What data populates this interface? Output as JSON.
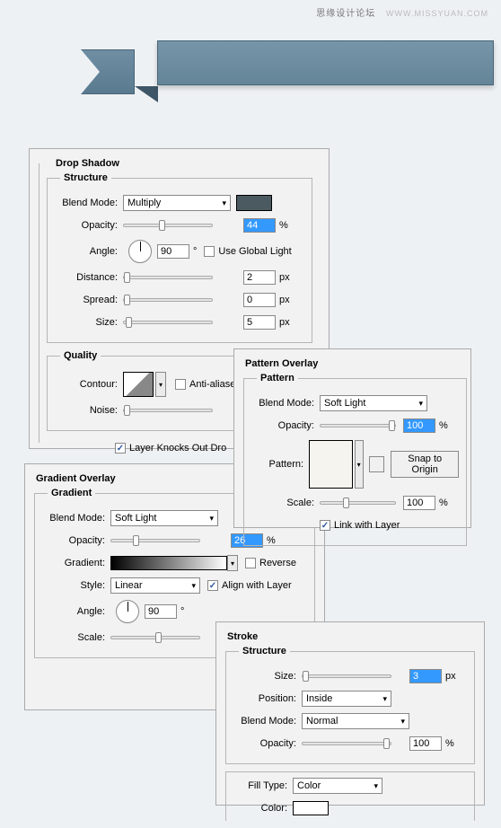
{
  "watermark": {
    "text": "思缘设计论坛",
    "url": "WWW.MISSYUAN.COM"
  },
  "drop_shadow": {
    "title": "Drop Shadow",
    "structure_label": "Structure",
    "blend_mode_label": "Blend Mode:",
    "blend_mode_value": "Multiply",
    "opacity_label": "Opacity:",
    "opacity_value": "44",
    "opacity_unit": "%",
    "angle_label": "Angle:",
    "angle_value": "90",
    "angle_unit": "°",
    "use_global_light": "Use Global Light",
    "distance_label": "Distance:",
    "distance_value": "2",
    "spread_label": "Spread:",
    "spread_value": "0",
    "size_label": "Size:",
    "size_value": "5",
    "px": "px",
    "quality_label": "Quality",
    "contour_label": "Contour:",
    "antialias": "Anti-aliase",
    "noise_label": "Noise:",
    "knockout": "Layer Knocks Out Dro"
  },
  "pattern_overlay": {
    "title": "Pattern Overlay",
    "pattern_label": "Pattern",
    "blend_mode_label": "Blend Mode:",
    "blend_mode_value": "Soft Light",
    "opacity_label": "Opacity:",
    "opacity_value": "100",
    "opacity_unit": "%",
    "pattern_field_label": "Pattern:",
    "snap_btn": "Snap to Origin",
    "scale_label": "Scale:",
    "scale_value": "100",
    "scale_unit": "%",
    "link_label": "Link with Layer"
  },
  "gradient_overlay": {
    "title": "Gradient Overlay",
    "gradient_label": "Gradient",
    "blend_mode_label": "Blend Mode:",
    "blend_mode_value": "Soft Light",
    "opacity_label": "Opacity:",
    "opacity_value": "26",
    "opacity_unit": "%",
    "gradient_field_label": "Gradient:",
    "reverse_label": "Reverse",
    "style_label": "Style:",
    "style_value": "Linear",
    "align_label": "Align with Layer",
    "angle_label": "Angle:",
    "angle_value": "90",
    "angle_unit": "°",
    "scale_label": "Scale:"
  },
  "stroke": {
    "title": "Stroke",
    "structure_label": "Structure",
    "size_label": "Size:",
    "size_value": "3",
    "px": "px",
    "position_label": "Position:",
    "position_value": "Inside",
    "blend_mode_label": "Blend Mode:",
    "blend_mode_value": "Normal",
    "opacity_label": "Opacity:",
    "opacity_value": "100",
    "opacity_unit": "%",
    "fill_type_label": "Fill Type:",
    "fill_type_value": "Color",
    "color_label": "Color:"
  }
}
